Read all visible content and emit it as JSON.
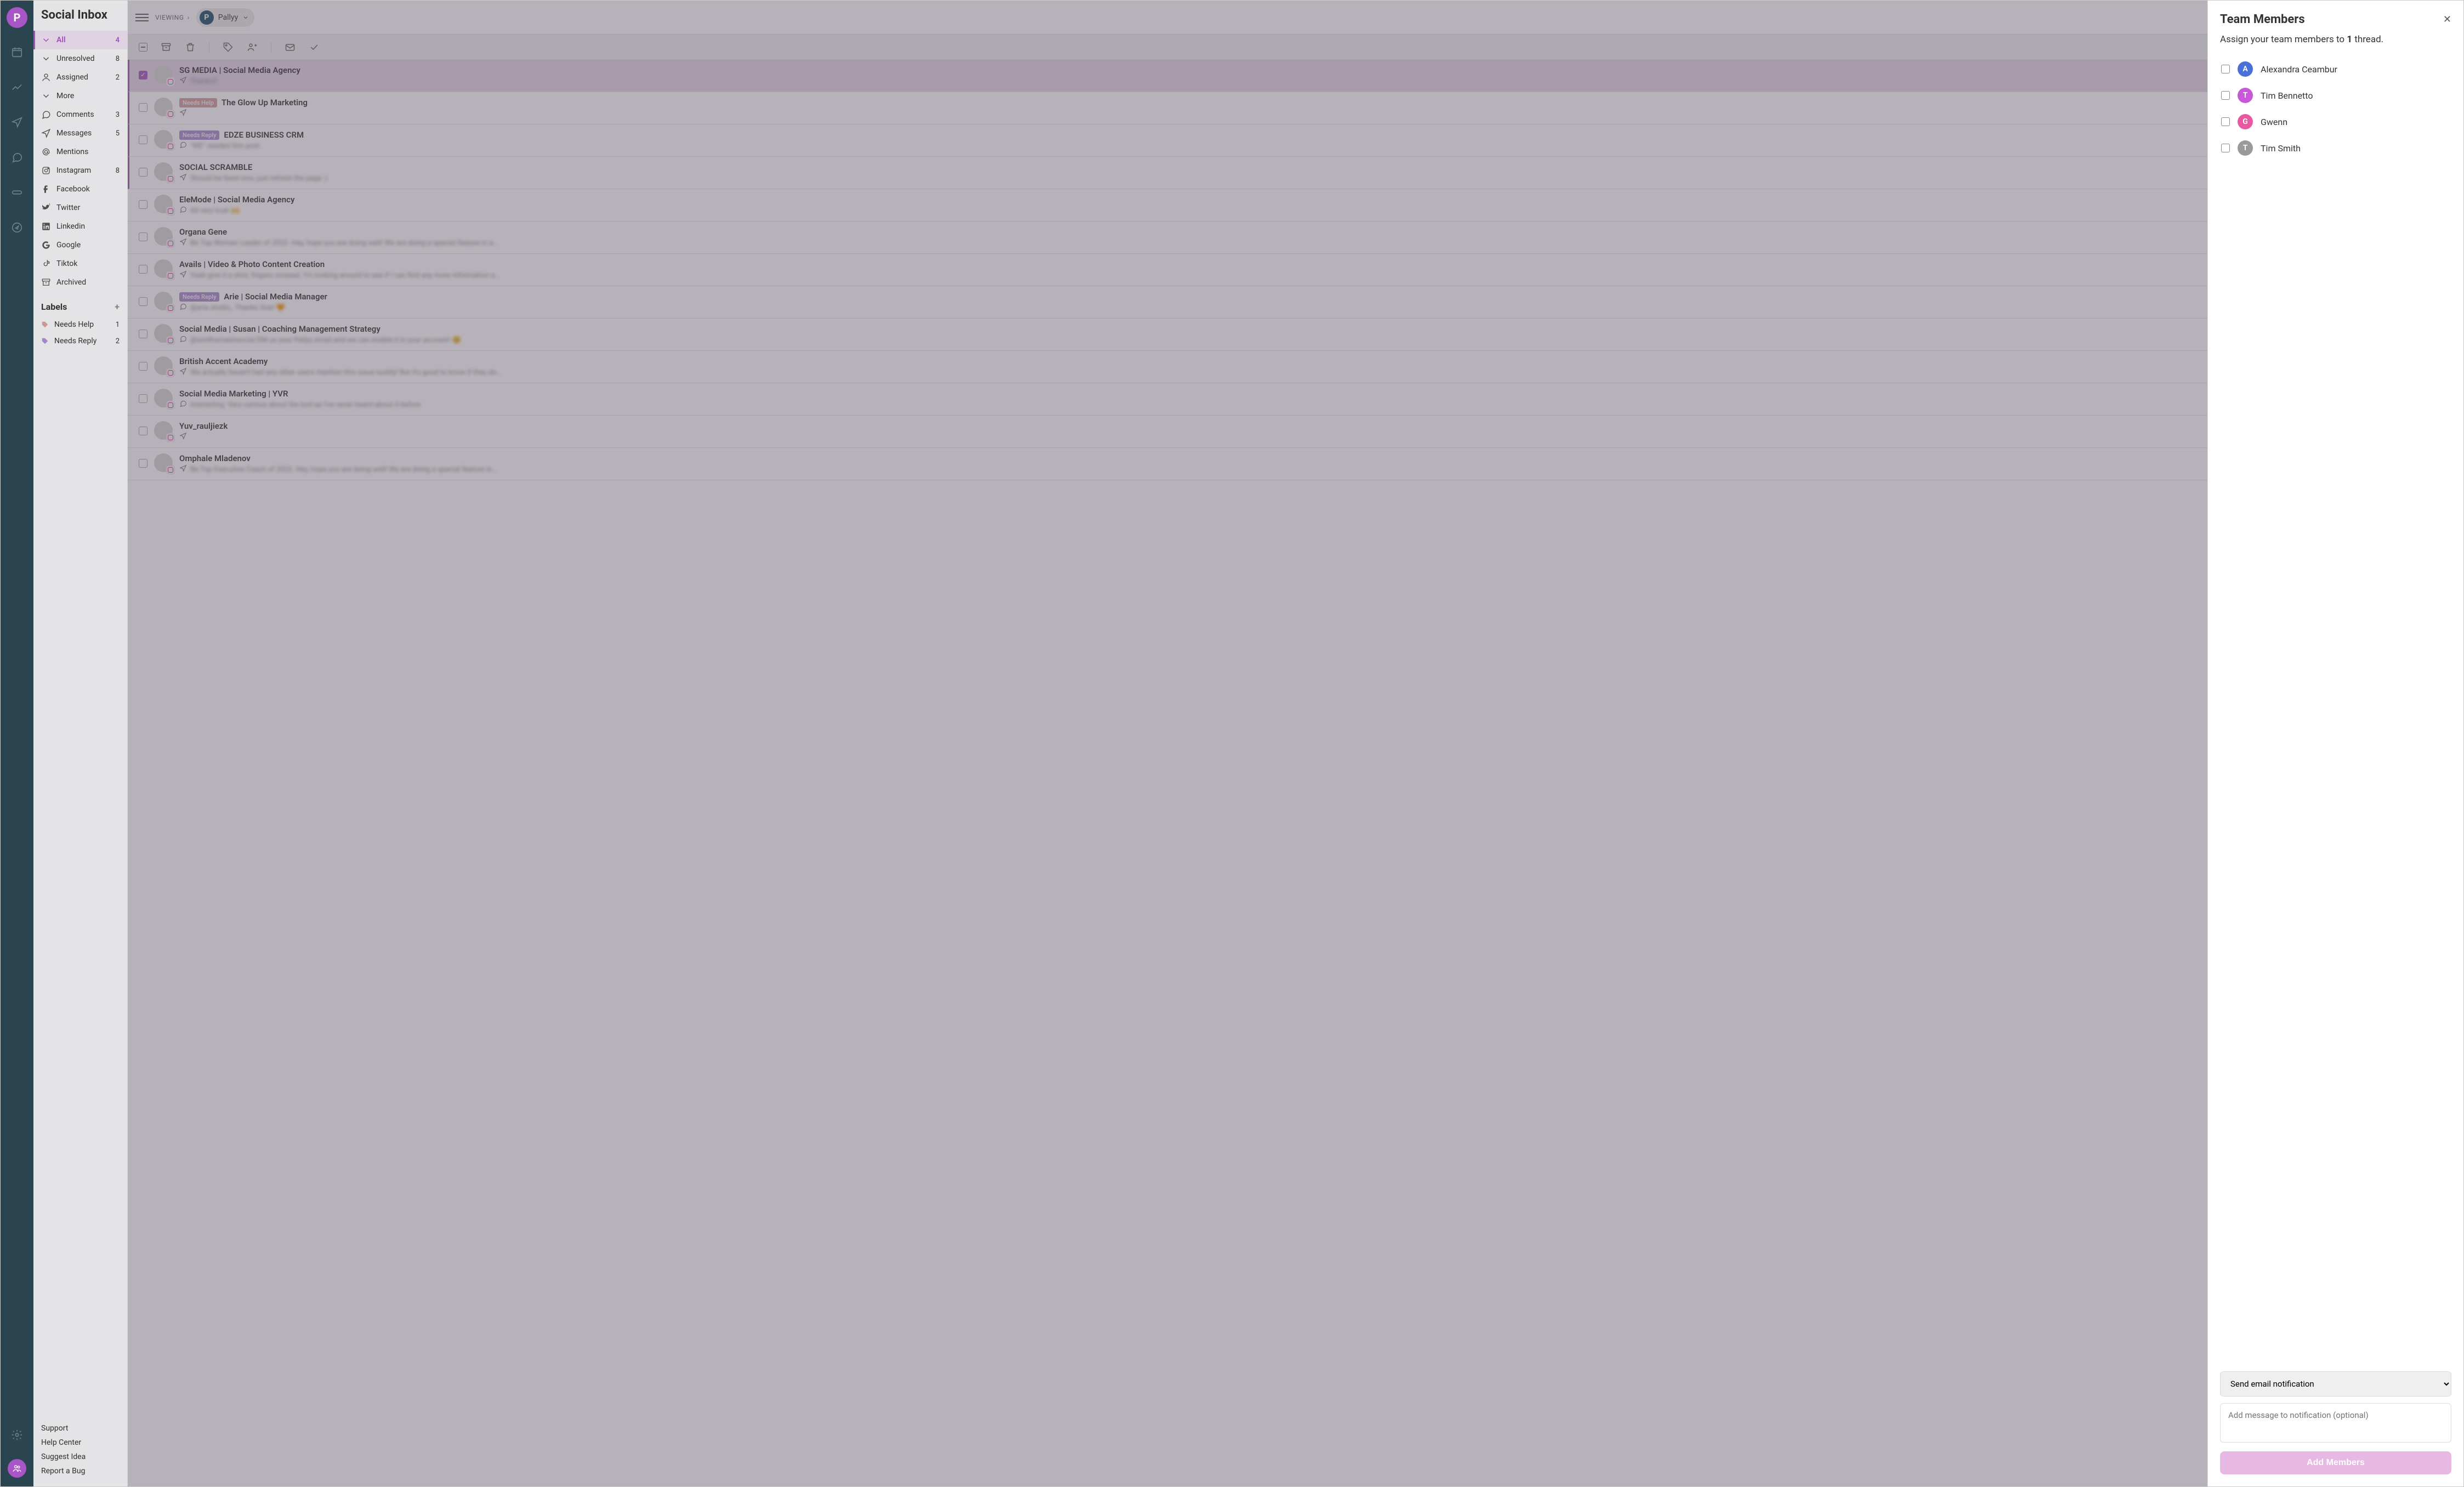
{
  "app_title": "Social Inbox",
  "viewing_label": "VIEWING",
  "workspace_name": "Pallyy",
  "sidebar": {
    "items": [
      {
        "icon": "chevron-down",
        "label": "All",
        "count": "4",
        "active": true
      },
      {
        "icon": "chevron-down",
        "label": "Unresolved",
        "count": "8"
      },
      {
        "icon": "user",
        "label": "Assigned",
        "count": "2"
      },
      {
        "icon": "chevron-down",
        "label": "More",
        "count": ""
      },
      {
        "icon": "comment",
        "label": "Comments",
        "count": "3"
      },
      {
        "icon": "send",
        "label": "Messages",
        "count": "5"
      },
      {
        "icon": "at",
        "label": "Mentions",
        "count": ""
      },
      {
        "icon": "instagram",
        "label": "Instagram",
        "count": "8"
      },
      {
        "icon": "facebook",
        "label": "Facebook",
        "count": ""
      },
      {
        "icon": "twitter",
        "label": "Twitter",
        "count": ""
      },
      {
        "icon": "linkedin",
        "label": "Linkedin",
        "count": ""
      },
      {
        "icon": "google",
        "label": "Google",
        "count": ""
      },
      {
        "icon": "tiktok",
        "label": "Tiktok",
        "count": ""
      },
      {
        "icon": "archive",
        "label": "Archived",
        "count": ""
      }
    ],
    "labels_header": "Labels",
    "labels": [
      {
        "color": "#d8a0a0",
        "label": "Needs Help",
        "count": "1"
      },
      {
        "color": "#b08fd8",
        "label": "Needs Reply",
        "count": "2"
      }
    ],
    "bottom_links": [
      "Support",
      "Help Center",
      "Suggest Idea",
      "Report a Bug"
    ]
  },
  "threads": [
    {
      "accent": true,
      "selected": true,
      "badge": "",
      "badgeColor": "",
      "name": "SG MEDIA | Social Media Agency",
      "icon": "send",
      "preview": "Thanks!!"
    },
    {
      "accent": true,
      "badge": "Needs Help",
      "badgeColor": "#d8a0a0",
      "name": "The Glow Up Marketing",
      "icon": "send",
      "preview": ""
    },
    {
      "accent": true,
      "badge": "Needs Reply",
      "badgeColor": "#b08fd8",
      "name": "EDZE BUSINESS CRM",
      "icon": "comment",
      "preview": "\"WE\" needed this post."
    },
    {
      "accent": true,
      "badge": "",
      "name": "SOCIAL SCRAMBLE",
      "icon": "send",
      "preview": "Should be fixed now, just refresh the page :)"
    },
    {
      "badge": "",
      "name": "EleMode | Social Media Agency",
      "icon": "comment",
      "preview": "All very true! 🙌"
    },
    {
      "badge": "",
      "name": "Organa Gene",
      "icon": "send",
      "preview": "Be Top Women Leader of 2022. Hey, hope you are doing well! We are doing a special feature in a..."
    },
    {
      "badge": "",
      "name": "Avails | Video & Photo Content Creation",
      "icon": "send",
      "preview": "Yeah give it a shot, fingers crossed. I'm looking around to see if I can find any more information a..."
    },
    {
      "badge": "Needs Reply",
      "badgeColor": "#b08fd8",
      "name": "Arie | Social Media Manager",
      "icon": "comment",
      "preview": "@arie.studio_ Thanks Arie! 🧡"
    },
    {
      "badge": "",
      "name": "Social Media | Susan | Coaching Management Strategy",
      "icon": "comment",
      "preview": "@smithsmashsocial DM us your Pallyy email and we can enable it in your account! 😊"
    },
    {
      "badge": "",
      "name": "British Accent Academy",
      "icon": "send",
      "preview": "We actually haven't had any other users mention this issue luckily! But it's good to know if they do..."
    },
    {
      "badge": "",
      "name": "Social Media Marketing | YVR",
      "icon": "comment",
      "preview": "Interesting. Very curious about the tool as I've never heard about it before"
    },
    {
      "badge": "",
      "name": "Yuv_rauljiezk",
      "icon": "send",
      "preview": ""
    },
    {
      "badge": "",
      "name": "Omphale Mladenov",
      "icon": "send",
      "preview": "Be Top Executive Coach of 2022. Hey, hope you are doing well! We are doing a special feature in..."
    }
  ],
  "panel": {
    "title": "Team Members",
    "subtitle_prefix": "Assign your team members to ",
    "subtitle_count": "1",
    "subtitle_suffix": " thread.",
    "members": [
      {
        "initial": "A",
        "color": "#4a6fd8",
        "name": "Alexandra Ceambur"
      },
      {
        "initial": "T",
        "color": "#c858d8",
        "name": "Tim Bennetto"
      },
      {
        "initial": "G",
        "color": "#e85aa0",
        "name": "Gwenn"
      },
      {
        "initial": "T",
        "color": "#9a9a9a",
        "name": "Tim Smith"
      }
    ],
    "select_label": "Send email notification",
    "textarea_placeholder": "Add message to notification (optional)",
    "button_label": "Add Members"
  }
}
